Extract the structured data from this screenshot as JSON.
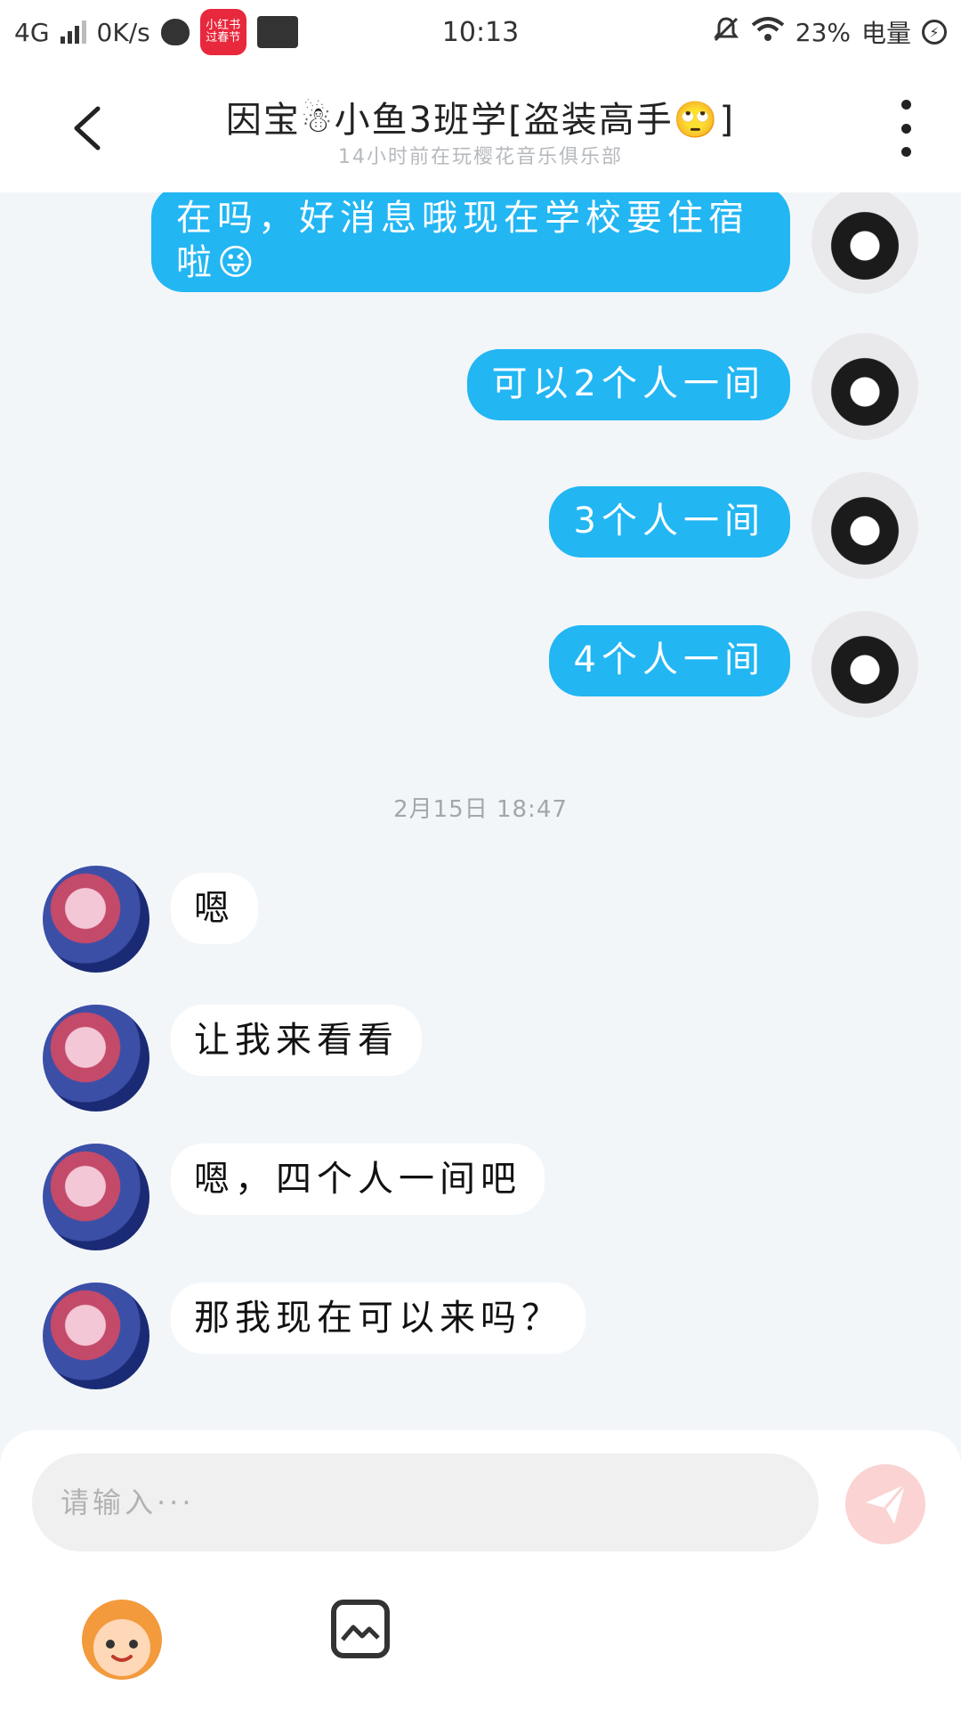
{
  "status_bar": {
    "network": "4G",
    "speed": "0K/s",
    "app_badge_line1": "小红书",
    "app_badge_line2": "过春节",
    "time": "10:13",
    "battery": "23%",
    "battery_label": "电量"
  },
  "header": {
    "title": "因宝☃小鱼3班学[盗装高手🙄]",
    "subtitle": "14小时前在玩樱花音乐俱乐部"
  },
  "messages_out": [
    {
      "text": "在吗，好消息哦现在学校要住宿啦😜"
    },
    {
      "text": "可以2个人一间"
    },
    {
      "text": "3个人一间"
    },
    {
      "text": "4个人一间"
    }
  ],
  "timestamp": "2月15日 18:47",
  "messages_in": [
    {
      "text": "嗯"
    },
    {
      "text": "让我来看看"
    },
    {
      "text": "嗯，四个人一间吧"
    },
    {
      "text": "那我现在可以来吗？"
    }
  ],
  "composer": {
    "placeholder": "请输入···"
  },
  "colors": {
    "outgoing_bubble": "#22b6f3",
    "background": "#f3f6f9",
    "send_button": "#fbd3d3"
  }
}
